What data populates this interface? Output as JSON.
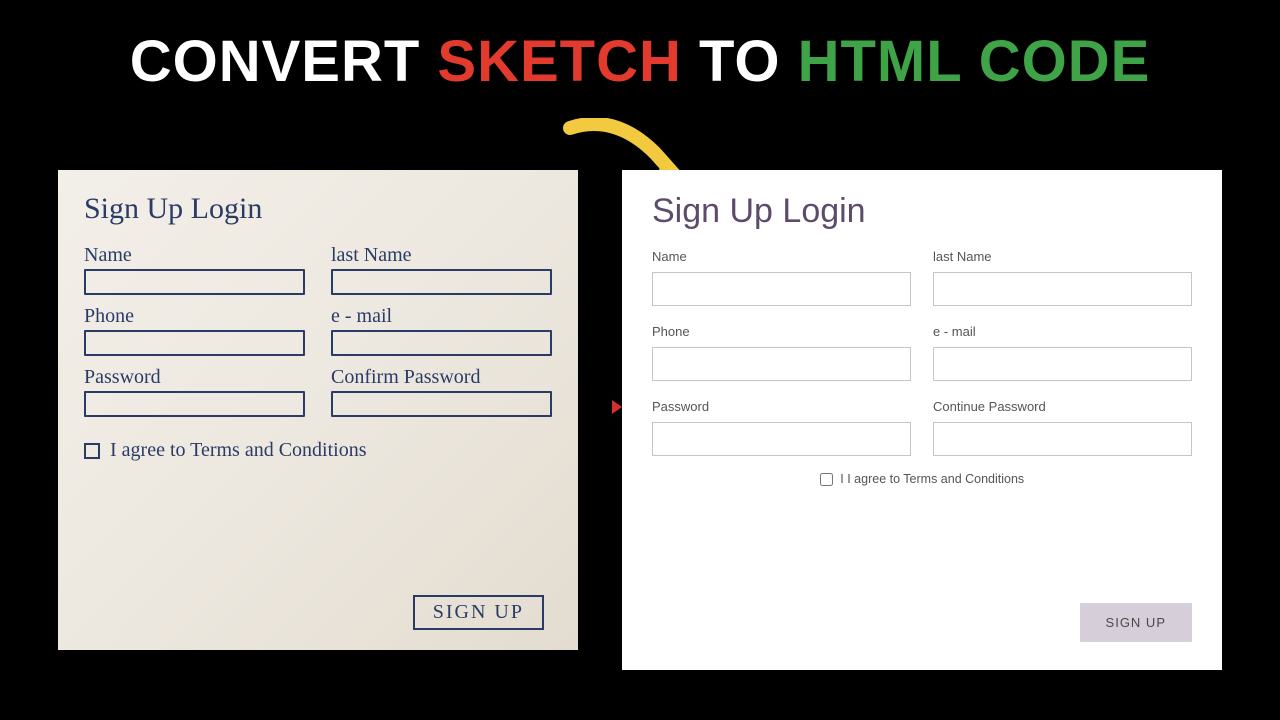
{
  "headline": {
    "w1": "CONVERT",
    "w2": "SKETCH",
    "w3": "TO",
    "w4": "HTML CODE"
  },
  "sketch": {
    "title": "Sign Up  Login",
    "fields": {
      "name": "Name",
      "lastName": "last Name",
      "phone": "Phone",
      "email": "e - mail",
      "password": "Password",
      "confirm": "Confirm Password"
    },
    "terms": "I agree to Terms and Conditions",
    "button": "SIGN UP"
  },
  "rendered": {
    "title": "Sign Up Login",
    "fields": {
      "name": "Name",
      "lastName": "last Name",
      "phone": "Phone",
      "email": "e - mail",
      "password": "Password",
      "confirm": "Continue Password"
    },
    "terms": "I I agree to Terms and Conditions",
    "button": "SIGN UP"
  },
  "colors": {
    "red": "#e23b2e",
    "green": "#3fa447",
    "arrow": "#f2c93f"
  }
}
